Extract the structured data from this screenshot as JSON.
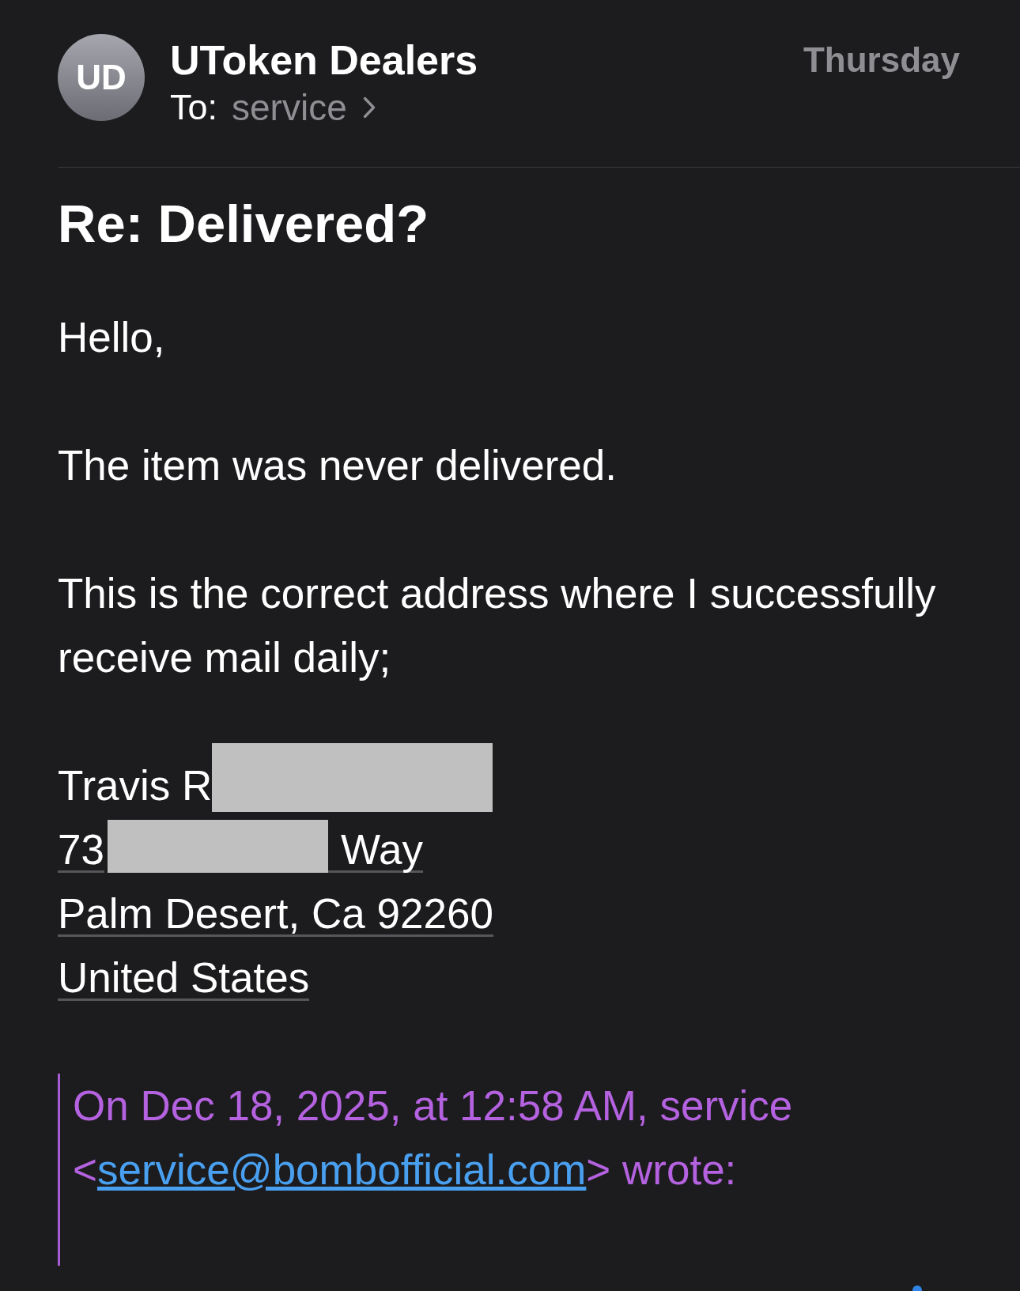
{
  "header": {
    "avatar": {
      "initials": "UD"
    },
    "sender": "UToken Dealers",
    "to_label": "To:",
    "recipient": "service",
    "date": "Thursday"
  },
  "subject": "Re: Delivered?",
  "body": {
    "paragraphs": [
      "Hello,",
      "The item was never delivered.",
      "This is the correct address where I successfully receive mail daily;"
    ],
    "address": [
      {
        "underlined": false,
        "parts": [
          {
            "kind": "text",
            "text": "Travis R"
          },
          {
            "kind": "redaction"
          }
        ]
      },
      {
        "underlined": true,
        "parts": [
          {
            "kind": "text",
            "text": "73"
          },
          {
            "kind": "redaction"
          },
          {
            "kind": "text",
            "text": "Way"
          }
        ]
      },
      {
        "underlined": true,
        "parts": [
          {
            "kind": "text",
            "text": "Palm Desert, Ca 92260"
          }
        ]
      },
      {
        "underlined": true,
        "parts": [
          {
            "kind": "text",
            "text": "United States"
          }
        ]
      }
    ]
  },
  "quote": {
    "attribution": [
      {
        "kind": "text",
        "text": "On Dec 18, 2025, at 12:58 AM, service <"
      },
      {
        "kind": "link",
        "text": "service@bombofficial.com"
      },
      {
        "kind": "text",
        "text": "> wrote:"
      }
    ]
  }
}
